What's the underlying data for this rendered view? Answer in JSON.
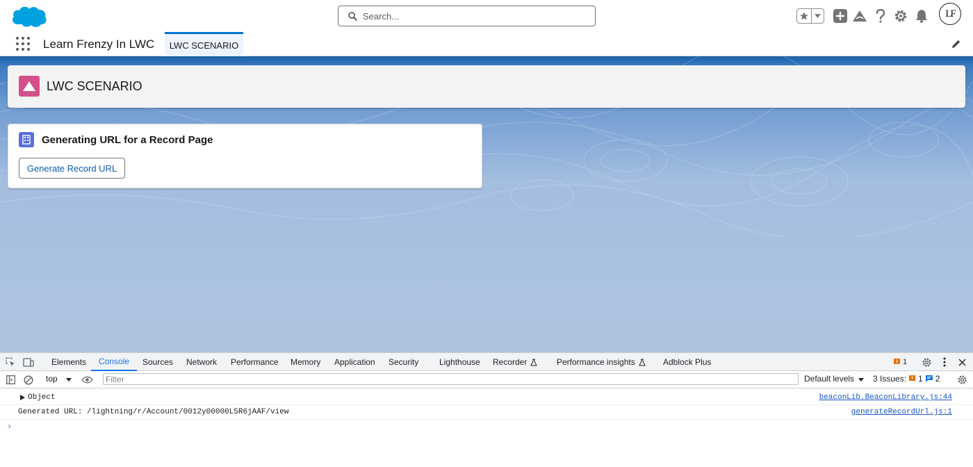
{
  "header": {
    "search_placeholder": "Search...",
    "avatar_initials": "LF"
  },
  "app_nav": {
    "app_name": "Learn Frenzy In LWC",
    "tabs": [
      {
        "label": "LWC SCENARIO",
        "active": true
      }
    ]
  },
  "page_header": {
    "title": "LWC SCENARIO"
  },
  "card": {
    "title": "Generating URL for a Record Page",
    "button_label": "Generate Record URL"
  },
  "devtools": {
    "tabs": [
      "Elements",
      "Console",
      "Sources",
      "Network",
      "Performance",
      "Memory",
      "Application",
      "Security",
      "Lighthouse",
      "Recorder",
      "Performance insights",
      "Adblock Plus"
    ],
    "active_tab": "Console",
    "warning_count": "1",
    "context": "top",
    "filter_placeholder": "Filter",
    "levels": "Default levels",
    "issues_label": "3 Issues:",
    "issues_warning": "1",
    "issues_info": "2",
    "messages": [
      {
        "text": "Object",
        "source": "beaconLib.BeaconLibrary.js:44"
      },
      {
        "text": "Generated URL: /lightning/r/Account/0012y00000L5R6jAAF/view",
        "source": "generateRecordUrl.js:1"
      }
    ],
    "prompt": "›"
  },
  "colors": {
    "brand_blue": "#0176d3",
    "page_icon": "#d4508a",
    "card_icon": "#5a6fd8",
    "devtools_active": "#1a73e8"
  }
}
